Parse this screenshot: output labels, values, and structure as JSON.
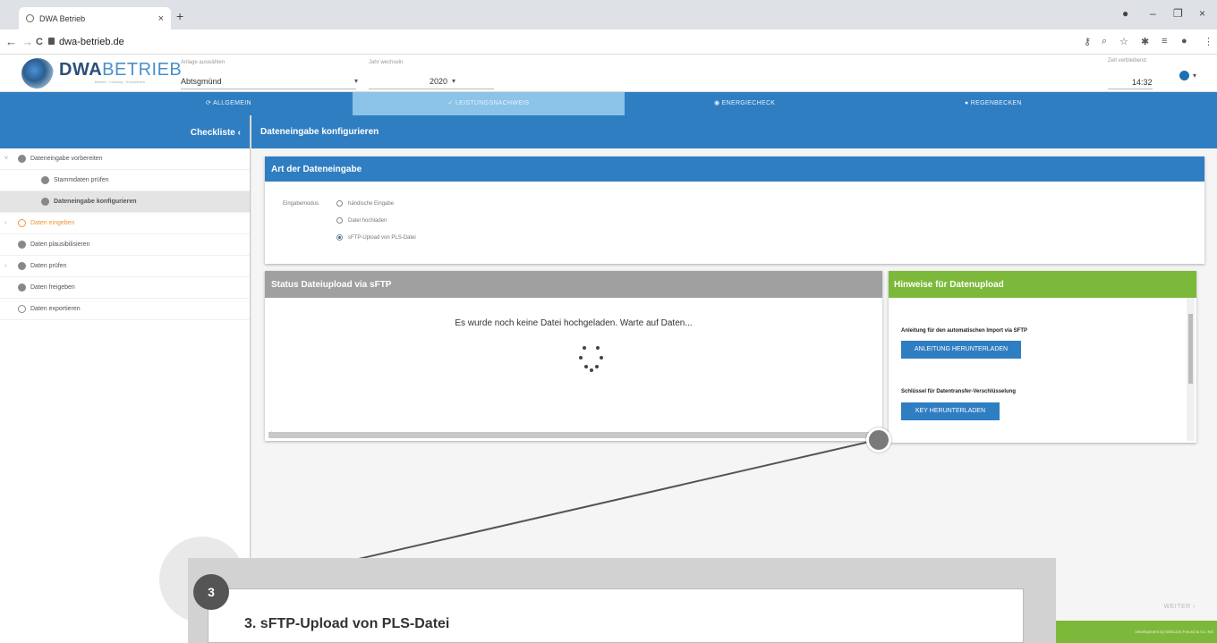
{
  "browser": {
    "tab_title": "DWA Betrieb",
    "url": "dwa-betrieb.de",
    "nav_back": "←",
    "nav_forward": "→",
    "nav_reload": "C"
  },
  "header": {
    "logo_bold": "DWA",
    "logo_light": "BETRIEB",
    "logo_sub": "Betrieb · Leistung · Kennzahlen",
    "anlage_label": "Anlage auswählen",
    "anlage_value": "Abtsgmünd",
    "jahr_label": "Jahr wechseln",
    "jahr_value": "2020",
    "zeit_label": "Zeit verbleibend",
    "zeit_value": "14:32"
  },
  "mainnav": {
    "tabs": [
      {
        "label": "ALLGEMEIN",
        "icon": "refresh-icon"
      },
      {
        "label": "LEISTUNGSNACHWEIS",
        "icon": "check-icon"
      },
      {
        "label": "ENERGIECHECK",
        "icon": "flash-icon"
      },
      {
        "label": "REGENBECKEN",
        "icon": "drop-icon"
      }
    ]
  },
  "sidebar": {
    "title": "Checkliste",
    "items": [
      {
        "label": "Dateneingabe vorbereiten"
      },
      {
        "label": "Stammdaten prüfen"
      },
      {
        "label": "Dateneingabe konfigurieren"
      },
      {
        "label": "Daten eingeben"
      },
      {
        "label": "Daten plausibilisieren"
      },
      {
        "label": "Daten prüfen"
      },
      {
        "label": "Daten freigeben"
      },
      {
        "label": "Daten exportieren"
      }
    ]
  },
  "main": {
    "title": "Dateneingabe konfigurieren",
    "art": {
      "title": "Art der Dateneingabe",
      "mode_label": "Eingabemodus",
      "options": [
        {
          "label": "händische Eingabe",
          "selected": false
        },
        {
          "label": "Datei hochladen",
          "selected": false
        },
        {
          "label": "sFTP-Upload von PLS-Datei",
          "selected": true
        }
      ]
    },
    "status": {
      "title": "Status Dateiupload via sFTP",
      "message": "Es wurde noch keine Datei hochgeladen. Warte auf Daten..."
    },
    "hints": {
      "title": "Hinweise für Datenupload",
      "anleitung_label": "Anleitung für den automatischen Import via SFTP",
      "anleitung_button": "ANLEITUNG HERUNTERLADEN",
      "key_label": "Schlüssel für Datentransfer-Verschlüsselung",
      "key_button": "KEY HERUNTERLADEN"
    },
    "weiter": "WEITER",
    "footer": "Development by DIGILUX Freund & Co. KG"
  },
  "callout": {
    "number": "3",
    "title": "3. sFTP-Upload von PLS-Datei"
  },
  "colors": {
    "primary_blue": "#2f7ec2",
    "active_tab": "#8cc3e8",
    "green": "#7cb93a",
    "gray_header": "#a0a0a0",
    "orange": "#f0943a"
  }
}
